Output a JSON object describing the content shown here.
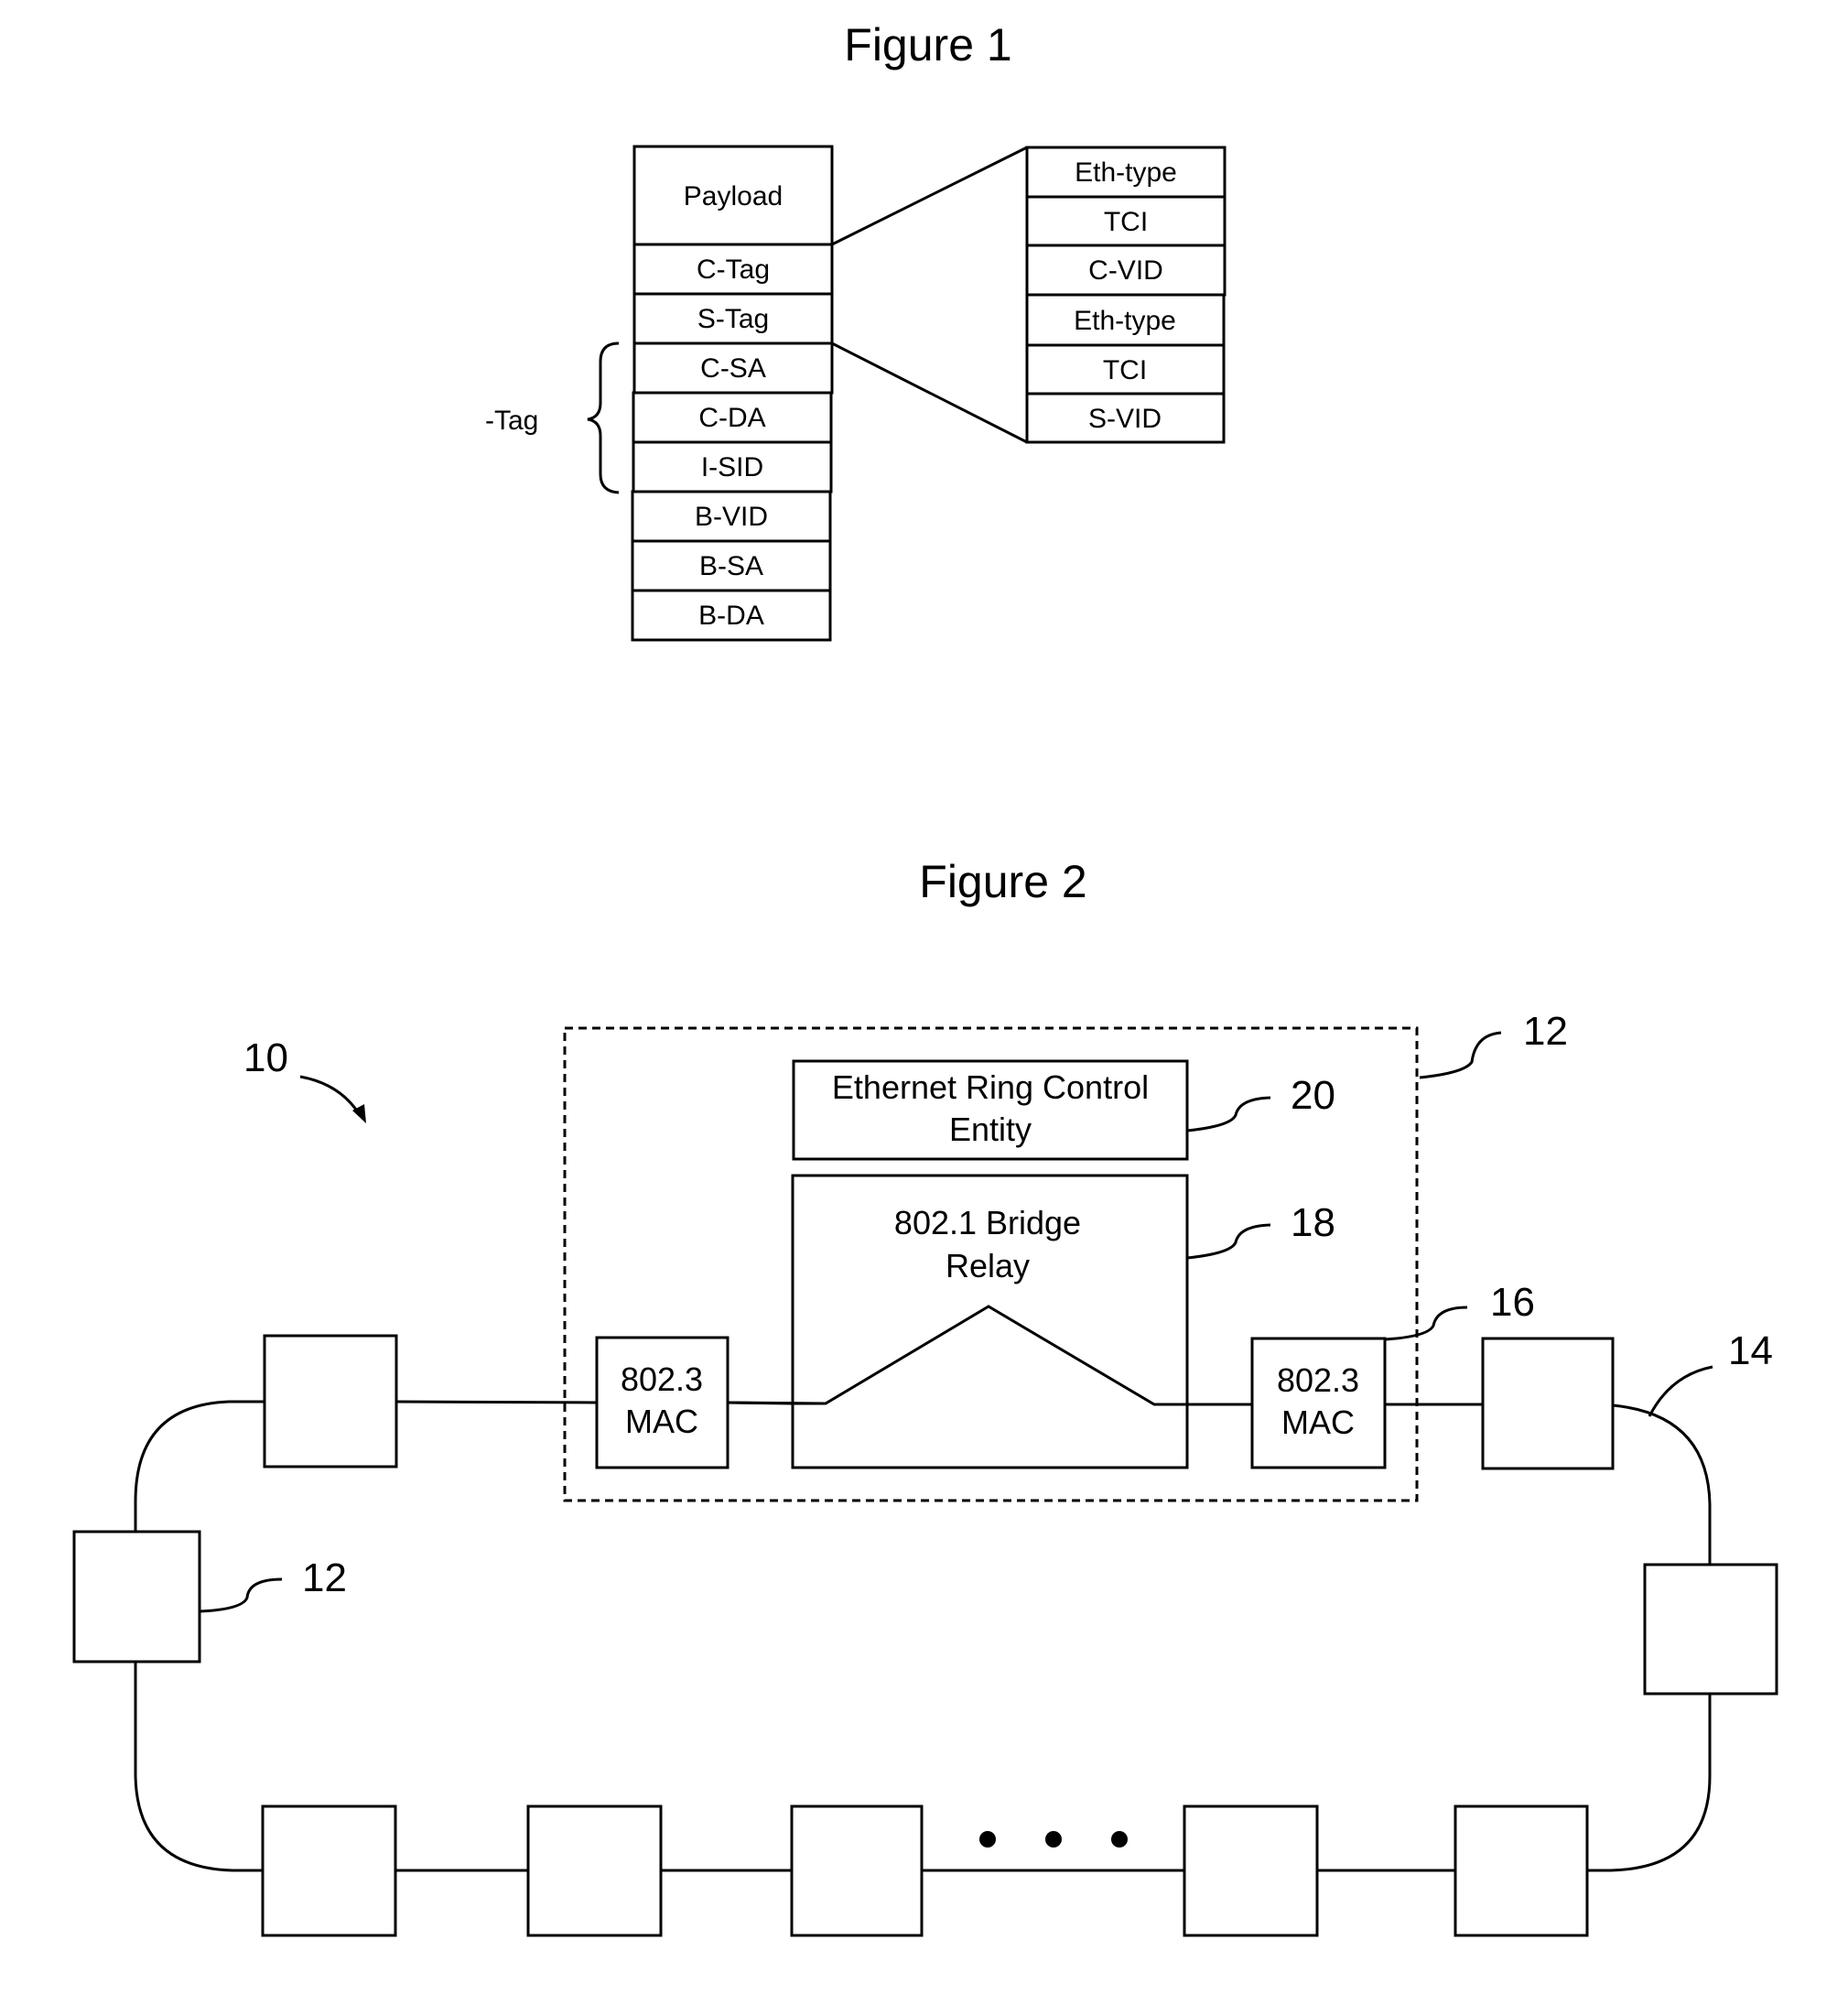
{
  "figure1": {
    "title": "Figure 1",
    "frame_stack": [
      "Payload",
      "C-Tag",
      "S-Tag",
      "C-SA",
      "C-DA",
      "I-SID",
      "B-VID",
      "B-SA",
      "B-DA"
    ],
    "tag_expansion": [
      "Eth-type",
      "TCI",
      "C-VID",
      "Eth-type",
      "TCI",
      "S-VID"
    ],
    "brace_label": "-Tag"
  },
  "figure2": {
    "title": "Figure 2",
    "node_box": {
      "control_entity_line1": "Ethernet Ring Control",
      "control_entity_line2": "Entity",
      "bridge_relay_line1": "802.1 Bridge",
      "bridge_relay_line2": "Relay",
      "mac_left_line1": "802.3",
      "mac_left_line2": "MAC",
      "mac_right_line1": "802.3",
      "mac_right_line2": "MAC"
    },
    "ref_numerals": {
      "ring": "10",
      "node_top": "12",
      "node_left": "12",
      "ring_link": "14",
      "mac": "16",
      "bridge_relay": "18",
      "control_entity": "20"
    },
    "ellipsis_dots": 3
  }
}
